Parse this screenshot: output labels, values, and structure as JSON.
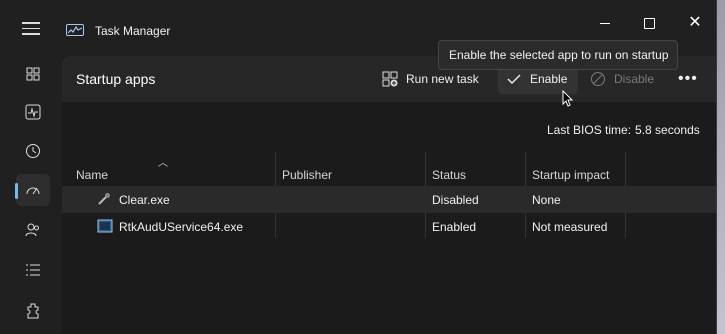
{
  "window": {
    "title": "Task Manager"
  },
  "sidebar": {
    "items": [
      {
        "icon": "processes-icon"
      },
      {
        "icon": "performance-icon"
      },
      {
        "icon": "app-history-icon"
      },
      {
        "icon": "startup-apps-icon",
        "active": true
      },
      {
        "icon": "users-icon"
      },
      {
        "icon": "details-icon"
      },
      {
        "icon": "services-icon"
      }
    ]
  },
  "toolbar": {
    "page_title": "Startup apps",
    "run_new_task": "Run new task",
    "enable": "Enable",
    "disable": "Disable",
    "more": "•••"
  },
  "tooltip": {
    "text": "Enable the selected app to run on startup"
  },
  "bios": {
    "label": "Last BIOS time:",
    "value": "5.8 seconds"
  },
  "table": {
    "columns": [
      "Name",
      "Publisher",
      "Status",
      "Startup impact"
    ],
    "rows": [
      {
        "name": "Clear.exe",
        "publisher": "",
        "status": "Disabled",
        "impact": "None"
      },
      {
        "name": "RtkAudUService64.exe",
        "publisher": "",
        "status": "Enabled",
        "impact": "Not measured"
      }
    ]
  },
  "colors": {
    "accent": "#76b9ed",
    "window_bg": "#202020",
    "content_bg": "#1b1b1b",
    "header_bg": "#272727"
  }
}
